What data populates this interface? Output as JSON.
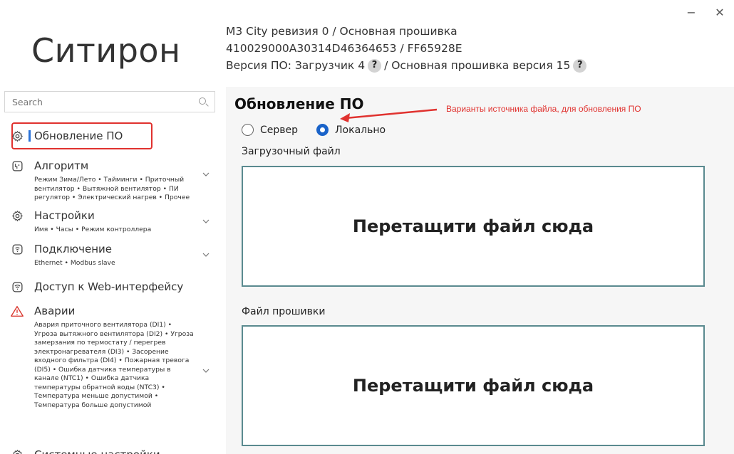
{
  "window": {
    "minimize": "−",
    "close": "✕"
  },
  "app": {
    "logo": "Ситирон"
  },
  "device": {
    "line1": "M3 City ревизия 0 / Основная прошивка",
    "line2": "410029000A30314D46364653 / FF65928E",
    "line3_prefix": "Версия ПО: Загрузчик 4",
    "line3_suffix": "/ Основная прошивка версия 15",
    "help": "?"
  },
  "search": {
    "placeholder": "Search"
  },
  "sidebar": {
    "items": [
      {
        "label": "Обновление ПО",
        "icon": "gear-icon",
        "active": true
      },
      {
        "label": "Алгоритм",
        "icon": "algorithm-icon",
        "sub": "Режим Зима/Лето • Тайминги • Приточный вентилятор • Вытяжной вентилятор • ПИ регулятор • Электрический нагрев • Прочее"
      },
      {
        "label": "Настройки",
        "icon": "gear-icon",
        "sub": "Имя • Часы • Режим контроллера"
      },
      {
        "label": "Подключение",
        "icon": "connection-icon",
        "sub": "Ethernet • Modbus slave"
      },
      {
        "label": "Доступ к Web-интерфейсу",
        "icon": "wifi-icon"
      },
      {
        "label": "Аварии",
        "icon": "warning-icon",
        "sub": "Авария приточного вентилятора (DI1) • Угроза вытяжного вентилятора (DI2) • Угроза замерзания по термостату / перегрев электронагревателя (DI3) • Засорение входного фильтра (DI4) • Пожарная тревога (DI5) • Ошибка датчика температуры в канале (NTC1) • Ошибка датчика температуры обратной воды (NTC3) • Температура меньше допустимой • Температура больше допустимой"
      },
      {
        "label": "Системные настройки",
        "icon": "gear-icon"
      }
    ]
  },
  "main": {
    "title": "Обновление ПО",
    "annotation": "Варианты источника файла, для обновления ПО",
    "source_options": [
      {
        "label": "Сервер",
        "selected": false
      },
      {
        "label": "Локально",
        "selected": true
      }
    ],
    "bootloader_label": "Загрузочный файл",
    "firmware_label": "Файл прошивки",
    "dropzone_text": "Перетащити файл сюда"
  },
  "colors": {
    "accent": "#1a63c9",
    "highlight": "#e0322f",
    "dropzone_border": "#5a8a8f",
    "warning": "#d9342b"
  }
}
